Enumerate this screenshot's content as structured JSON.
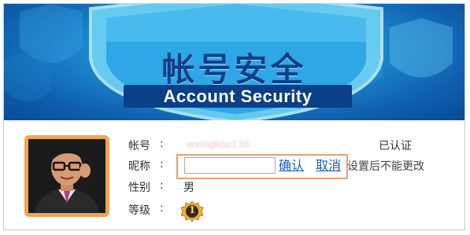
{
  "banner": {
    "title_cn": "帐号安全",
    "title_en": "Account Security"
  },
  "profile": {
    "account_label": "帐号",
    "account_value": "weingkoo136",
    "account_status": "已认证",
    "nickname_label": "昵称",
    "nickname_value": "",
    "nickname_placeholder": "",
    "confirm_label": "确认",
    "cancel_label": "取消",
    "nickname_hint": "设置后不能更改",
    "gender_label": "性别",
    "gender_value": "男",
    "level_label": "等级",
    "level_value": "1",
    "colon": ":"
  },
  "colors": {
    "banner_dark": "#0b3f87",
    "banner_light": "#4fc3ef",
    "highlight_border": "#e8a170",
    "avatar_border": "#f0a54e",
    "link": "#1a5fb4",
    "badge_gold": "#e8b23a"
  },
  "icons": {
    "banner": "shield-icon",
    "avatar": "cartoon-man-with-glasses",
    "level": "gold-medal-icon"
  }
}
